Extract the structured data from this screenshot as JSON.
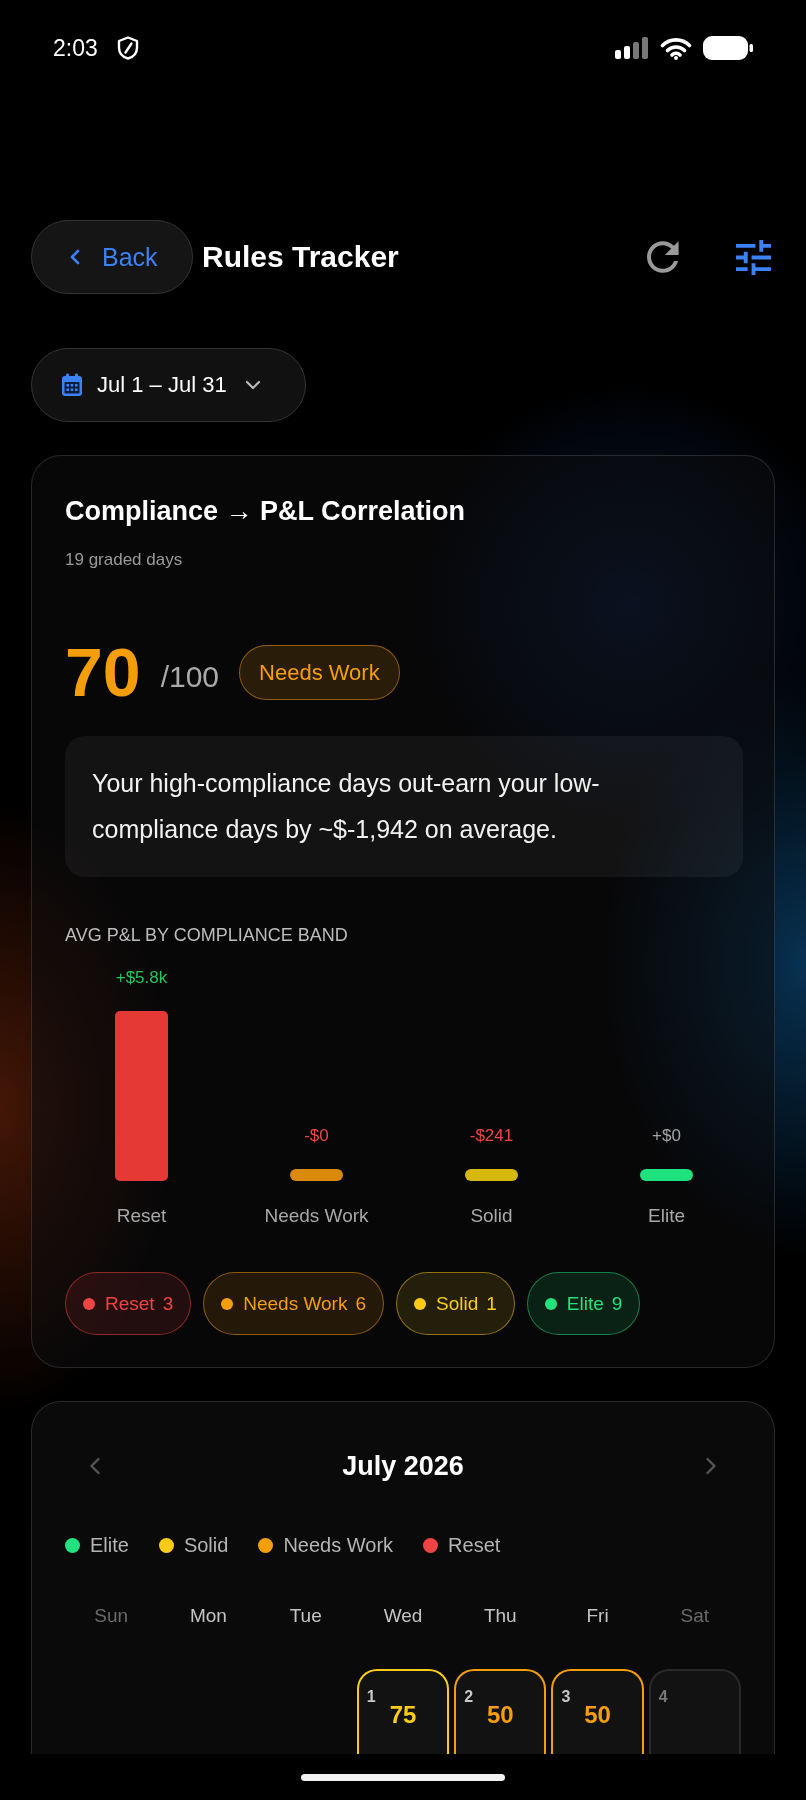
{
  "status_bar": {
    "time": "2:03"
  },
  "header": {
    "back_label": "Back",
    "title": "Rules Tracker"
  },
  "date_range": {
    "label": "Jul 1 – Jul 31"
  },
  "correlation_card": {
    "title": "Compliance → P&L Correlation",
    "subtitle": "19 graded days",
    "score": "70",
    "score_max": "/100",
    "grade": {
      "label": "Needs Work",
      "color": "#f59e0b"
    },
    "insight": "Your high-compliance days out-earn your low-compliance days by ~$-1,942 on average.",
    "chart_title": "AVG P&L BY COMPLIANCE BAND",
    "band_chart": {
      "bars": [
        {
          "label": "Reset",
          "value": {
            "text": "+$5.8k",
            "color": "#22c55e"
          },
          "kind": "tall",
          "color": "#e53935"
        },
        {
          "label": "Needs Work",
          "value": {
            "text": "-$0",
            "color": "#ef4444"
          },
          "kind": "stub",
          "color": "#d98a0b"
        },
        {
          "label": "Solid",
          "value": {
            "text": "-$241",
            "color": "#ef4444"
          },
          "kind": "stub",
          "color": "#d6b80c"
        },
        {
          "label": "Elite",
          "value": {
            "text": "+$0",
            "color": "#a3a3a3"
          },
          "kind": "stub",
          "color": "#1ee27d"
        }
      ]
    },
    "bands": [
      {
        "label": "Reset",
        "count": "3",
        "color": "#ef4444"
      },
      {
        "label": "Needs Work",
        "count": "6",
        "color": "#f59e0b"
      },
      {
        "label": "Solid",
        "count": "1",
        "color": "#facc15"
      },
      {
        "label": "Elite",
        "count": "9",
        "color": "#22e27d"
      }
    ]
  },
  "calendar": {
    "month": "July 2026",
    "legend": [
      {
        "label": "Elite",
        "color": "#22e27d"
      },
      {
        "label": "Solid",
        "color": "#facc15"
      },
      {
        "label": "Needs Work",
        "color": "#f59e0b"
      },
      {
        "label": "Reset",
        "color": "#ef4444"
      }
    ],
    "weekdays": [
      {
        "label": "Sun",
        "weekend": true
      },
      {
        "label": "Mon",
        "weekend": false
      },
      {
        "label": "Tue",
        "weekend": false
      },
      {
        "label": "Wed",
        "weekend": false
      },
      {
        "label": "Thu",
        "weekend": false
      },
      {
        "label": "Fri",
        "weekend": false
      },
      {
        "label": "Sat",
        "weekend": true
      }
    ],
    "days": [
      {
        "kind": "blank"
      },
      {
        "kind": "blank"
      },
      {
        "kind": "blank"
      },
      {
        "kind": "day",
        "day": "1",
        "score": "75",
        "color": "#facc15"
      },
      {
        "kind": "day",
        "day": "2",
        "score": "50",
        "color": "#f59e0b"
      },
      {
        "kind": "day",
        "day": "3",
        "score": "50",
        "color": "#f59e0b"
      },
      {
        "kind": "day",
        "day": "4"
      }
    ]
  }
}
